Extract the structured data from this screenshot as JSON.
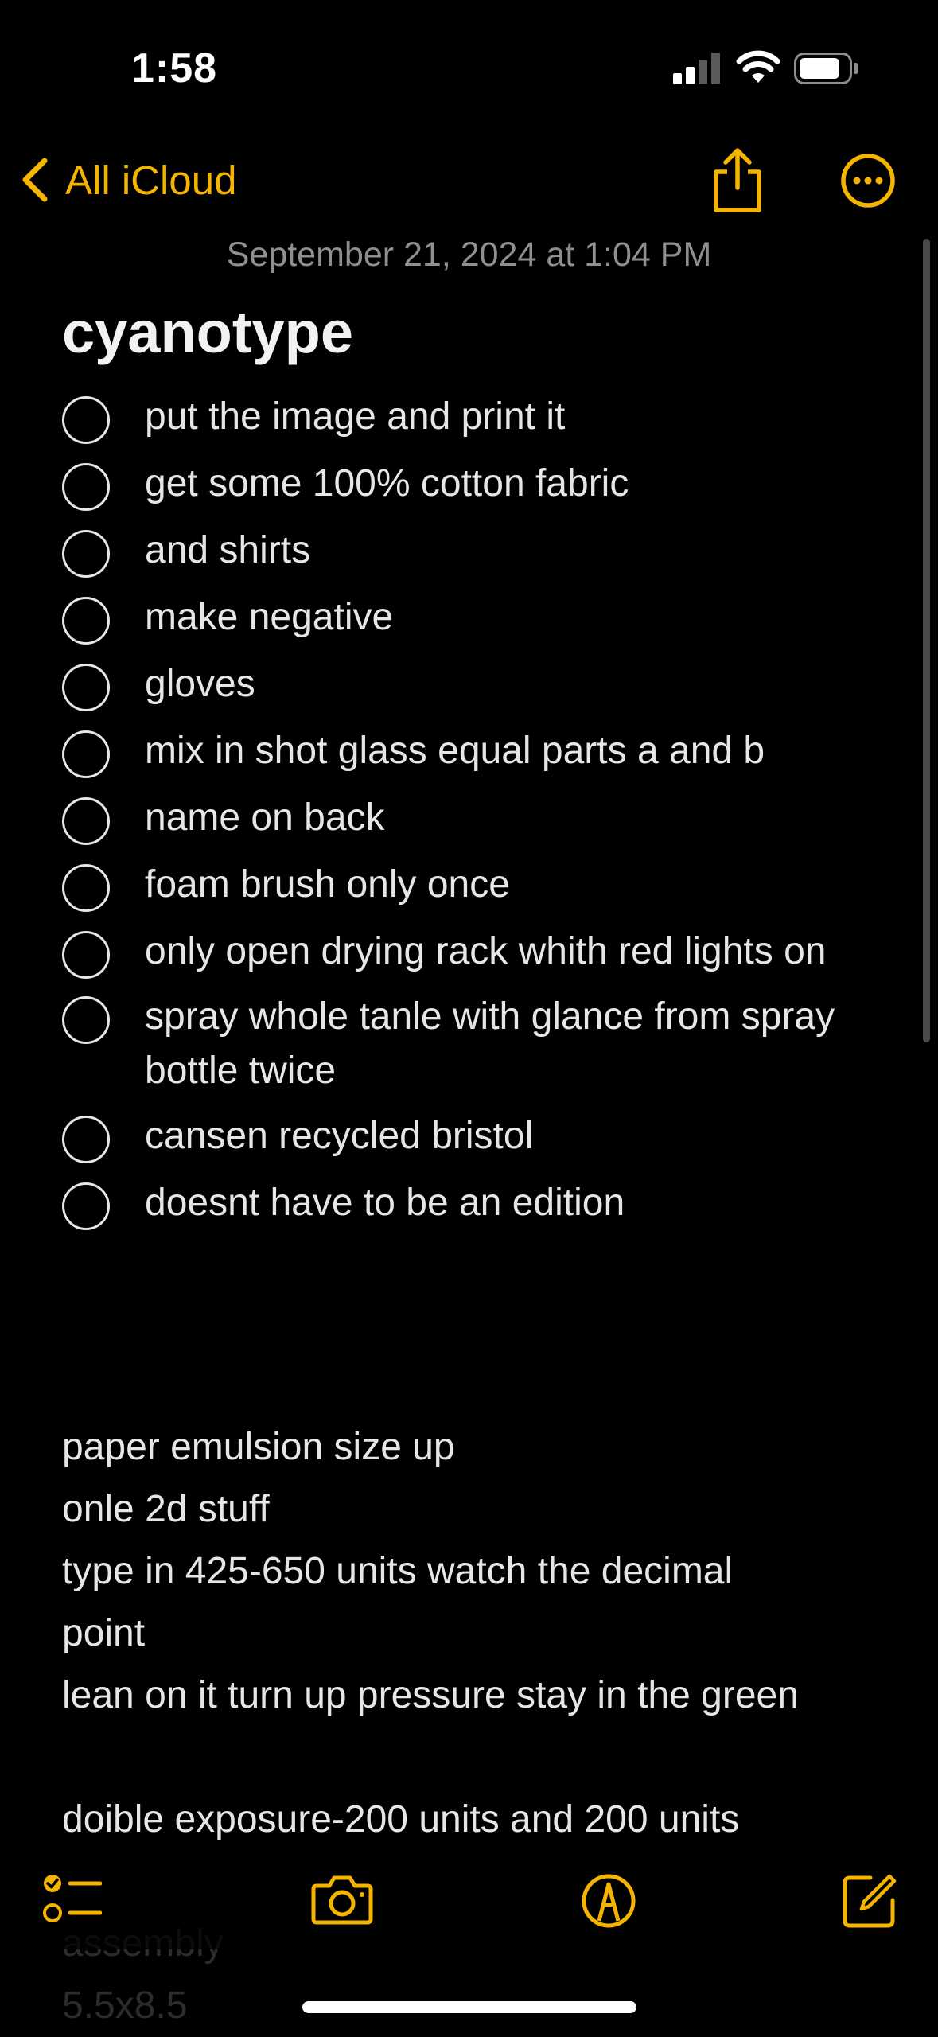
{
  "status_bar": {
    "time": "1:58"
  },
  "nav": {
    "back_label": "All iCloud"
  },
  "note": {
    "date": "September 21, 2024 at 1:04 PM",
    "title": "cyanotype",
    "checklist": [
      "put the image and print it",
      "get some 100% cotton fabric",
      "and shirts",
      "make negative",
      "gloves",
      "mix in shot glass equal parts a and b",
      "name on back",
      "foam brush only once",
      "only open drying rack whith red lights on",
      "spray whole tanle with glance from spray bottle twice",
      "cansen recycled bristol",
      "doesnt have to be an edition"
    ],
    "lines": [
      "paper emulsion size up",
      "onle 2d stuff",
      "type in 425-650 units watch the decimal",
      "point",
      "lean on it  turn up pressure stay in the green",
      "",
      "doible exposure-200 units and 200 units",
      "",
      "assembly",
      "5.5x8.5"
    ]
  },
  "colors": {
    "accent": "#f4b400",
    "background": "#000000",
    "text": "#e6e6e6",
    "secondary": "#8e8e93"
  },
  "toolbar": {
    "icons": [
      "checklist-icon",
      "camera-icon",
      "markup-pen-icon",
      "compose-icon"
    ]
  }
}
